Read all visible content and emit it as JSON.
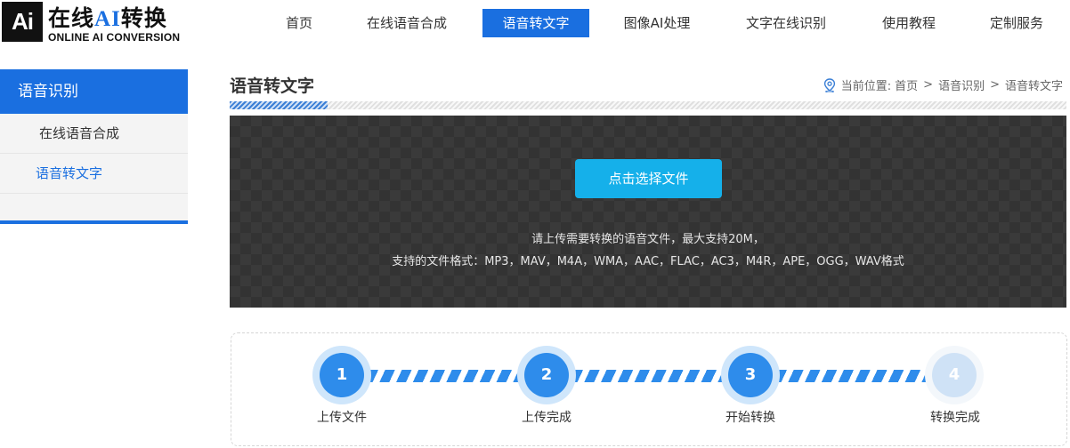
{
  "logo": {
    "mark": "Ai",
    "title_prefix": "在线",
    "title_ai": "AI",
    "title_suffix": "转换",
    "subtitle": "ONLINE AI CONVERSION"
  },
  "nav": {
    "items": [
      {
        "label": "首页"
      },
      {
        "label": "在线语音合成"
      },
      {
        "label": "语音转文字"
      },
      {
        "label": "图像AI处理"
      },
      {
        "label": "文字在线识别"
      },
      {
        "label": "使用教程"
      },
      {
        "label": "定制服务"
      }
    ],
    "active_index": 2
  },
  "sidebar": {
    "heading": "语音识别",
    "items": [
      {
        "label": "在线语音合成"
      },
      {
        "label": "语音转文字"
      }
    ]
  },
  "main": {
    "title": "语音转文字",
    "breadcrumb": {
      "prefix": "当前位置:",
      "items": [
        "首页",
        "语音识别",
        "语音转文字"
      ],
      "separator": ">"
    }
  },
  "upload": {
    "button_label": "点击选择文件",
    "hint_line1": "请上传需要转换的语音文件，最大支持20M，",
    "hint_line2": "支持的文件格式：MP3，MAV，M4A，WMA，AAC，FLAC，AC3，M4R，APE，OGG，WAV格式"
  },
  "steps": [
    {
      "number": "1",
      "label": "上传文件",
      "state": "done"
    },
    {
      "number": "2",
      "label": "上传完成",
      "state": "done"
    },
    {
      "number": "3",
      "label": "开始转换",
      "state": "done"
    },
    {
      "number": "4",
      "label": "转换完成",
      "state": "pending"
    }
  ],
  "colors": {
    "brand": "#1a6fe0",
    "upload_button": "#15b0ea",
    "step_active": "#2e8ceb",
    "step_pending": "#cfe2f6"
  }
}
